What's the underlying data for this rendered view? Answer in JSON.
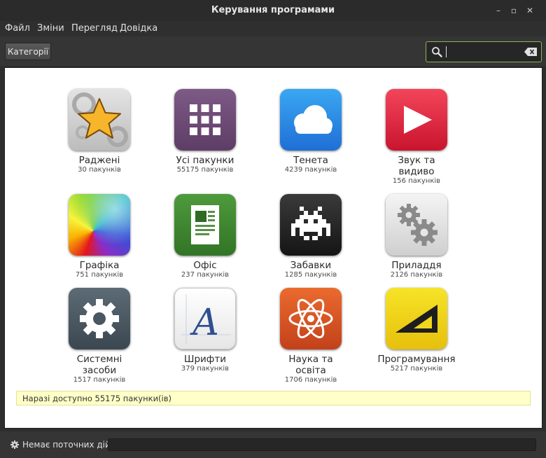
{
  "window": {
    "title": "Керування програмами"
  },
  "menu": [
    "Файл",
    "Зміни",
    "Перегляд",
    "Довідка"
  ],
  "toolbar": {
    "categories_label": "Категорії",
    "search_value": ""
  },
  "tiles": [
    {
      "name": "Раджені",
      "count": "30 пакунків",
      "icon": "star-icon"
    },
    {
      "name": "Усі пакунки",
      "count": "55175 пакунків",
      "icon": "grid-icon"
    },
    {
      "name": "Тенета",
      "count": "4239 пакунків",
      "icon": "cloud-icon"
    },
    {
      "name": "Звук та видиво",
      "count": "156 пакунків",
      "icon": "play-icon"
    },
    {
      "name": "Графіка",
      "count": "751 пакунків",
      "icon": "rainbow-icon"
    },
    {
      "name": "Офіс",
      "count": "237 пакунків",
      "icon": "document-icon"
    },
    {
      "name": "Забавки",
      "count": "1285 пакунків",
      "icon": "space-invader-icon"
    },
    {
      "name": "Приладдя",
      "count": "2126 пакунків",
      "icon": "gears-icon"
    },
    {
      "name": "Системні засоби",
      "count": "1517 пакунків",
      "icon": "cog-icon"
    },
    {
      "name": "Шрифти",
      "count": "379 пакунків",
      "icon": "font-icon"
    },
    {
      "name": "Наука та освіта",
      "count": "1706 пакунків",
      "icon": "atom-icon"
    },
    {
      "name": "Програмування",
      "count": "5217 пакунків",
      "icon": "set-square-icon"
    }
  ],
  "available_message": "Наразі доступно 55175 пакунки(ів)",
  "status": {
    "label": "Немає поточних дій"
  },
  "colors": {
    "accent": "#8fb358",
    "notice_bg": "#ffffc7"
  }
}
